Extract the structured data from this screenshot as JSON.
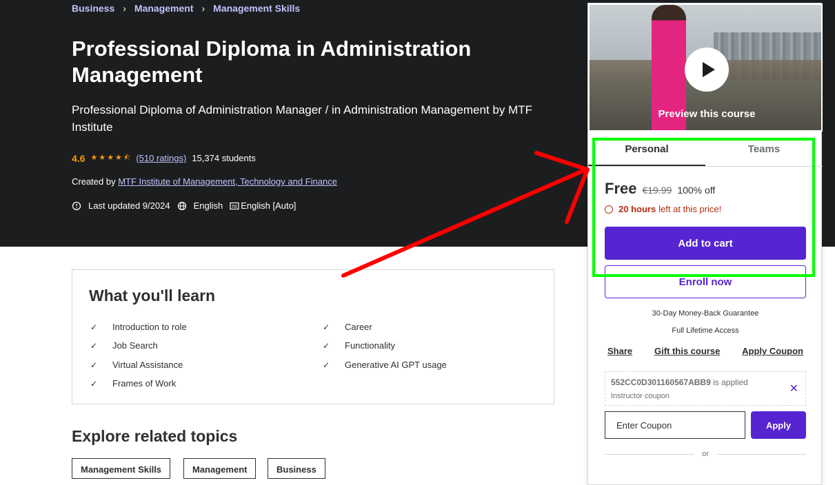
{
  "breadcrumb": [
    "Business",
    "Management",
    "Management Skills"
  ],
  "course": {
    "title": "Professional Diploma in Administration Management",
    "subtitle": "Professional Diploma of Administration Manager / in Administration Management by MTF Institute",
    "rating": "4.6",
    "ratings_count": "(510 ratings)",
    "students": "15,374 students",
    "created_by_label": "Created by",
    "creator": "MTF Institute of Management, Technology and Finance",
    "last_updated": "Last updated 9/2024",
    "language": "English",
    "captions": "English [Auto]"
  },
  "learn": {
    "title": "What you'll learn",
    "items_left": [
      "Introduction to role",
      "Job Search",
      "Virtual Assistance",
      "Frames of Work"
    ],
    "items_right": [
      "Career",
      "Functionality",
      "Generative AI GPT usage"
    ]
  },
  "explore": {
    "title": "Explore related topics",
    "topics": [
      "Management Skills",
      "Management",
      "Business"
    ]
  },
  "sidebar": {
    "preview_label": "Preview this course",
    "tabs": [
      "Personal",
      "Teams"
    ],
    "price": "Free",
    "original_price": "€19.99",
    "discount": "100% off",
    "timer_bold": "20 hours",
    "timer_rest": "left at this price!",
    "add_to_cart": "Add to cart",
    "enroll": "Enroll now",
    "guarantee": "30-Day Money-Back Guarantee",
    "lifetime": "Full Lifetime Access",
    "links": [
      "Share",
      "Gift this course",
      "Apply Coupon"
    ],
    "coupon_code": "552CC0D301160567ABB9",
    "coupon_applied": "is applied",
    "coupon_type": "Instructor coupon",
    "coupon_placeholder": "Enter Coupon",
    "apply": "Apply",
    "or": "or"
  },
  "colors": {
    "hero_bg": "#1c1d1f",
    "accent": "#5624d0",
    "link": "#c0c4fc",
    "star": "#f69c08",
    "timer": "#b32d0f",
    "highlight_box": "#00ff00",
    "arrow": "#ff0000"
  }
}
